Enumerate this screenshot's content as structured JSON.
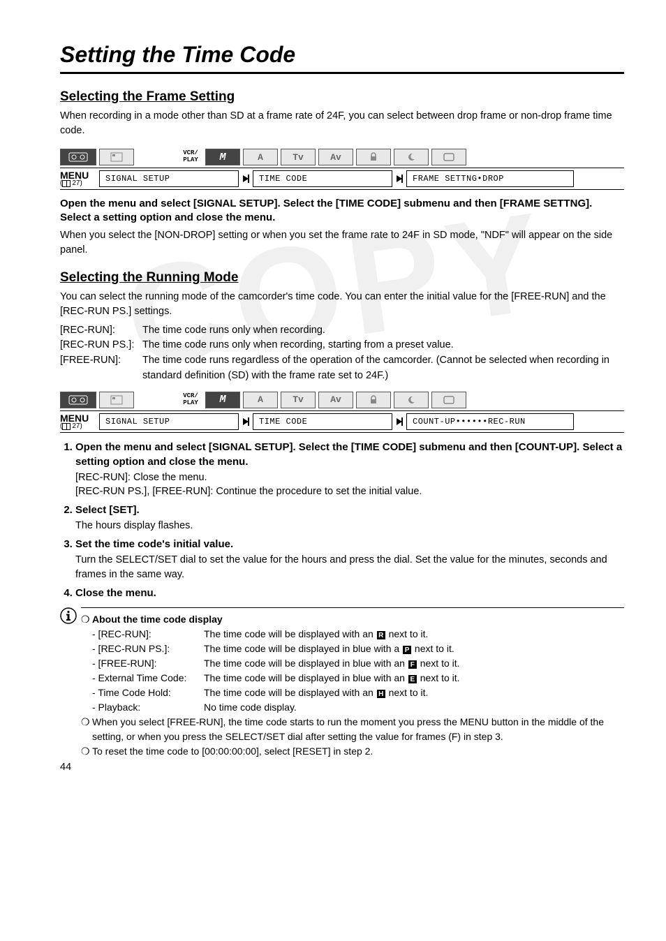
{
  "page_title": "Setting the Time Code",
  "page_number": "44",
  "watermark": "COPY",
  "section1": {
    "heading": "Selecting the Frame Setting",
    "intro": "When recording in a mode other than SD at a frame rate of 24F, you can select between drop frame or non-drop frame time code.",
    "mode_label_top": "VCR/",
    "mode_label_bottom": "PLAY",
    "menu_label": "MENU",
    "menu_ref": "27)",
    "menu_box1": "SIGNAL SETUP",
    "menu_box2": "TIME CODE",
    "menu_box3": "FRAME SETTNG•DROP",
    "instr": "Open the menu and select [SIGNAL SETUP]. Select the [TIME CODE] submenu and then [FRAME SETTNG]. Select a setting option and close the menu.",
    "para": "When you select the [NON-DROP] setting or when you set the frame rate to 24F in SD mode, \"NDF\" will appear on the side panel."
  },
  "section2": {
    "heading": "Selecting the Running Mode",
    "intro": "You can select the running mode of the camcorder's time code. You can enter the initial value for the [FREE-RUN] and the [REC-RUN PS.] settings.",
    "defs": [
      {
        "term": "[REC-RUN]:",
        "desc": "The time code runs only when recording."
      },
      {
        "term": "[REC-RUN PS.]:",
        "desc": "The time code runs only when recording, starting from a preset value."
      },
      {
        "term": "[FREE-RUN]:",
        "desc": "The time code runs regardless of the operation of the camcorder. (Cannot be selected when recording in standard definition (SD) with the frame rate set to 24F.)"
      }
    ],
    "mode_label_top": "VCR/",
    "mode_label_bottom": "PLAY",
    "menu_label": "MENU",
    "menu_ref": "27)",
    "menu_box1": "SIGNAL SETUP",
    "menu_box2": "TIME CODE",
    "menu_box3": "COUNT-UP••••••REC-RUN",
    "steps": [
      {
        "title": "Open the menu and select [SIGNAL SETUP]. Select the [TIME CODE] submenu and then [COUNT-UP]. Select a setting option and close the menu.",
        "sub": "[REC-RUN]:  Close the menu.\n[REC-RUN PS.], [FREE-RUN]:   Continue the procedure to set the initial value."
      },
      {
        "title": "Select [SET].",
        "sub": "The hours display flashes."
      },
      {
        "title": "Set the time code's initial value.",
        "sub": "Turn the SELECT/SET dial to set the value for the hours and press the dial. Set the value for the minutes, seconds and frames in the same way."
      },
      {
        "title": "Close the menu.",
        "sub": ""
      }
    ]
  },
  "info": {
    "heading": "About the time code display",
    "rows": [
      {
        "term": "- [REC-RUN]:",
        "desc_pre": "The time code will be displayed with an ",
        "glyph": "R",
        "desc_post": " next to it."
      },
      {
        "term": "- [REC-RUN PS.]:",
        "desc_pre": "The time code will be displayed in blue with a ",
        "glyph": "P",
        "desc_post": " next to it."
      },
      {
        "term": "- [FREE-RUN]:",
        "desc_pre": "The time code will be displayed in blue with an ",
        "glyph": "F",
        "desc_post": " next to it."
      },
      {
        "term": "- External Time Code:",
        "desc_pre": "The time code will be displayed in blue with an ",
        "glyph": "E",
        "desc_post": " next to it."
      },
      {
        "term": "- Time Code Hold:",
        "desc_pre": "The time code will be displayed with an ",
        "glyph": "H",
        "desc_post": " next to it."
      },
      {
        "term": "- Playback:",
        "desc_pre": "No time code display.",
        "glyph": "",
        "desc_post": ""
      }
    ],
    "note2": "When you select [FREE-RUN], the time code starts to run the moment you press the MENU button in the middle of the setting, or when you press the SELECT/SET dial after setting the value for frames (F) in step 3.",
    "note3": "To reset the time code to [00:00:00:00], select [RESET] in step 2."
  }
}
